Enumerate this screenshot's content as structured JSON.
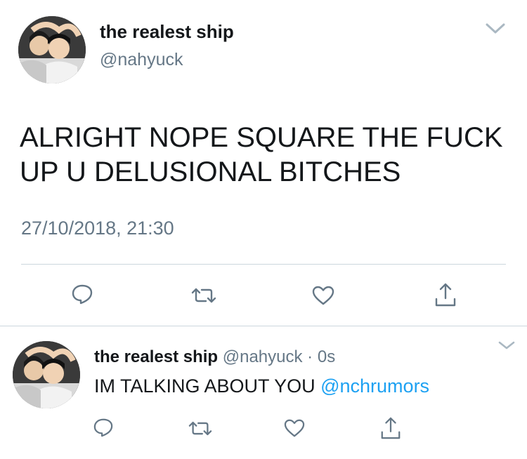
{
  "main_tweet": {
    "display_name": "the realest ship",
    "handle": "@nahyuck",
    "text_line1": "ALRIGHT NOPE SQUARE THE FUCK",
    "text_line2": "UP U DELUSIONAL BITCHES",
    "timestamp": "27/10/2018, 21:30",
    "actions": [
      "reply-icon",
      "retweet-icon",
      "like-icon",
      "share-icon"
    ],
    "menu_icon": "chevron-down-icon"
  },
  "reply_tweet": {
    "display_name": "the realest ship",
    "handle": "@nahyuck",
    "separator": "·",
    "time": "0s",
    "text": "IM TALKING ABOUT YOU",
    "mention": "@nchrumors",
    "actions": [
      "reply-icon",
      "retweet-icon",
      "like-icon",
      "share-icon"
    ],
    "menu_icon": "chevron-down-icon"
  },
  "colors": {
    "text": "#14171a",
    "secondary": "#657786",
    "link": "#1da1f2",
    "divider": "#ccd6dd"
  }
}
